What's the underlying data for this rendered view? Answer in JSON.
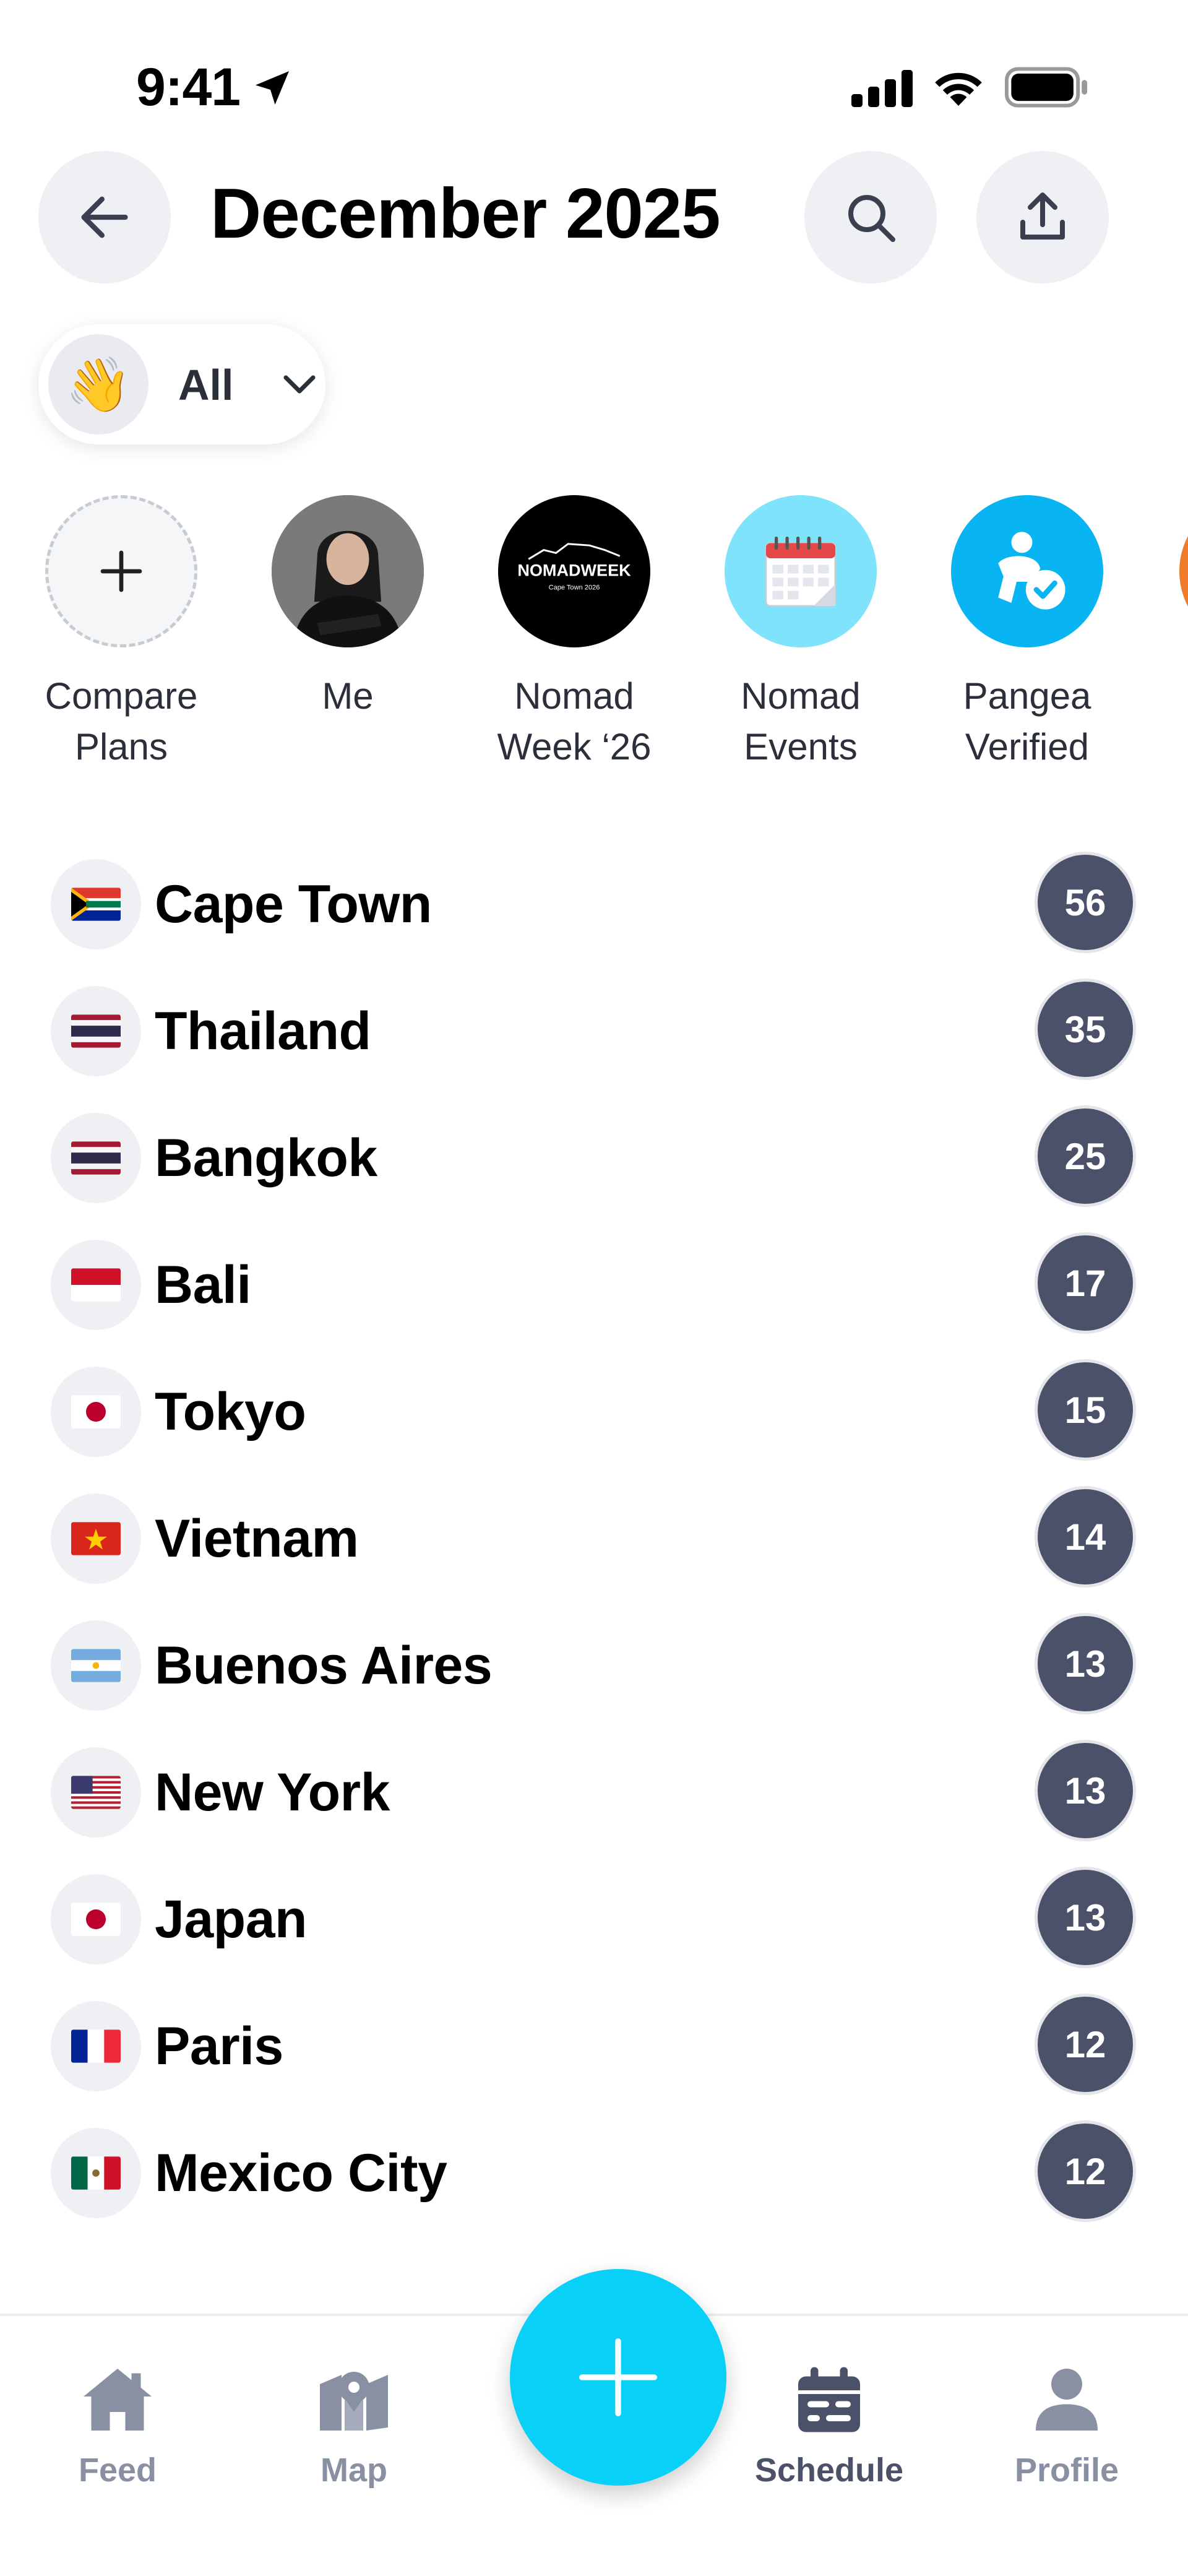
{
  "status_bar": {
    "time": "9:41"
  },
  "header": {
    "title": "December 2025"
  },
  "filter": {
    "emoji": "👋",
    "label": "All"
  },
  "stories": [
    {
      "label": "Compare\nPlans",
      "icon": "plus-icon"
    },
    {
      "label": "Me",
      "icon": "avatar"
    },
    {
      "label": "Nomad\nWeek ‘26",
      "icon": "nomad-week-logo",
      "logo_text": "NOMADWEEK",
      "logo_subtext": "Cape Town 2026"
    },
    {
      "label": "Nomad\nEvents",
      "icon": "calendar-icon"
    },
    {
      "label": "Pangea\nVerified",
      "icon": "verified-person-icon"
    }
  ],
  "destinations": [
    {
      "name": "Cape Town",
      "count": "56",
      "flag": "south-africa"
    },
    {
      "name": "Thailand",
      "count": "35",
      "flag": "thailand"
    },
    {
      "name": "Bangkok",
      "count": "25",
      "flag": "thailand"
    },
    {
      "name": "Bali",
      "count": "17",
      "flag": "indonesia"
    },
    {
      "name": "Tokyo",
      "count": "15",
      "flag": "japan"
    },
    {
      "name": "Vietnam",
      "count": "14",
      "flag": "vietnam"
    },
    {
      "name": "Buenos Aires",
      "count": "13",
      "flag": "argentina"
    },
    {
      "name": "New York",
      "count": "13",
      "flag": "usa"
    },
    {
      "name": "Japan",
      "count": "13",
      "flag": "japan"
    },
    {
      "name": "Paris",
      "count": "12",
      "flag": "france"
    },
    {
      "name": "Mexico City",
      "count": "12",
      "flag": "mexico"
    }
  ],
  "bottom_nav": {
    "items": [
      {
        "label": "Feed",
        "icon": "home-icon"
      },
      {
        "label": "Map",
        "icon": "map-icon"
      },
      {
        "label": "Schedule",
        "icon": "calendar-icon",
        "active": true
      },
      {
        "label": "Profile",
        "icon": "person-icon"
      }
    ],
    "fab_icon": "plus-icon"
  },
  "colors": {
    "accent": "#08d0f7",
    "badge": "#4b5169",
    "inactive_nav": "#8a90a3"
  }
}
